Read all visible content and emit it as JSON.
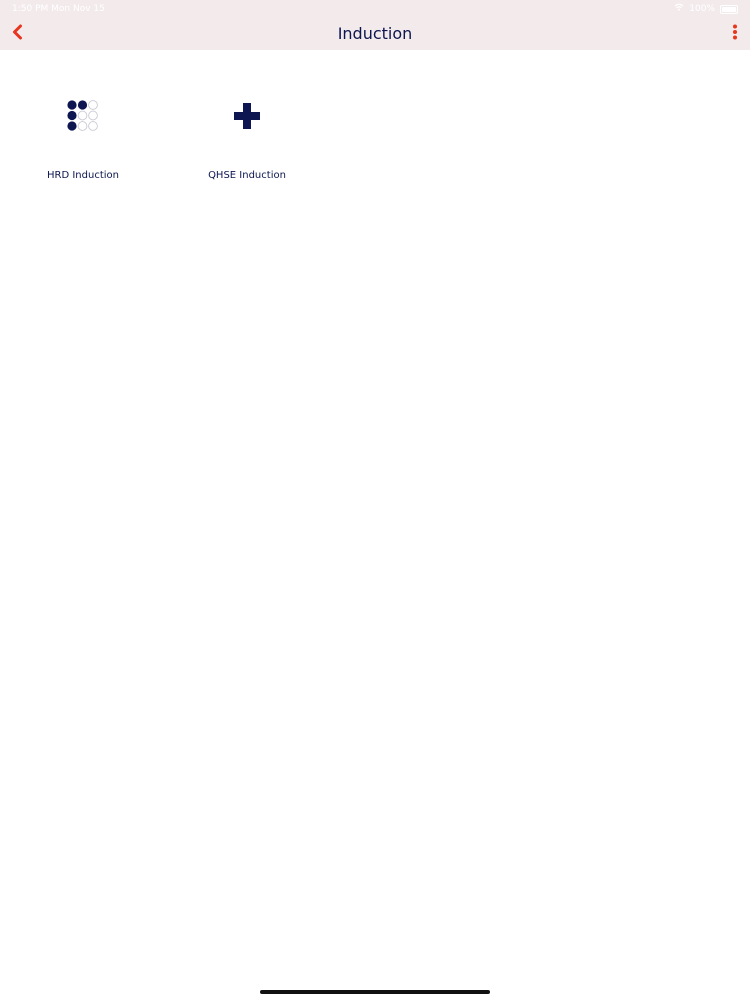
{
  "status_bar": {
    "time": "1:50 PM",
    "date": "Mon Nov 15",
    "battery_text": "100%",
    "battery_level": 1.0
  },
  "nav_bar": {
    "title": "Induction",
    "back_icon": "chevron-left-icon",
    "more_icon": "vertical-ellipsis-icon"
  },
  "tiles": [
    {
      "label": "HRD Induction",
      "icon": "dot-grid-icon"
    },
    {
      "label": "QHSE Induction",
      "icon": "plus-cross-icon"
    }
  ],
  "colors": {
    "accent": "#e8351e",
    "navy": "#0d1650",
    "nav_background": "#f3eaec",
    "dot_outline": "#c9cad3"
  }
}
